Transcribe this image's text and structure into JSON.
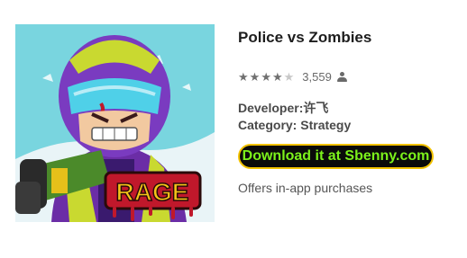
{
  "app": {
    "title": "Police vs Zombies",
    "icon_name": "rage-soldier-app-icon",
    "icon_badge_text": "RAGE",
    "rating": {
      "stars_filled": 4,
      "stars_total": 5,
      "count": "3,559",
      "user_icon": "person-icon"
    },
    "developer_label": "Developer:",
    "developer_value": "许飞",
    "category_label": "Category:",
    "category_value": "Strategy",
    "download_label": "Download it at Sbenny.com",
    "in_app": "Offers in-app purchases"
  },
  "colors": {
    "download_bg": "#0a0a0a",
    "download_text": "#7cf21b",
    "download_border": "#f2c200",
    "icon_bg": "#6fd0da"
  }
}
